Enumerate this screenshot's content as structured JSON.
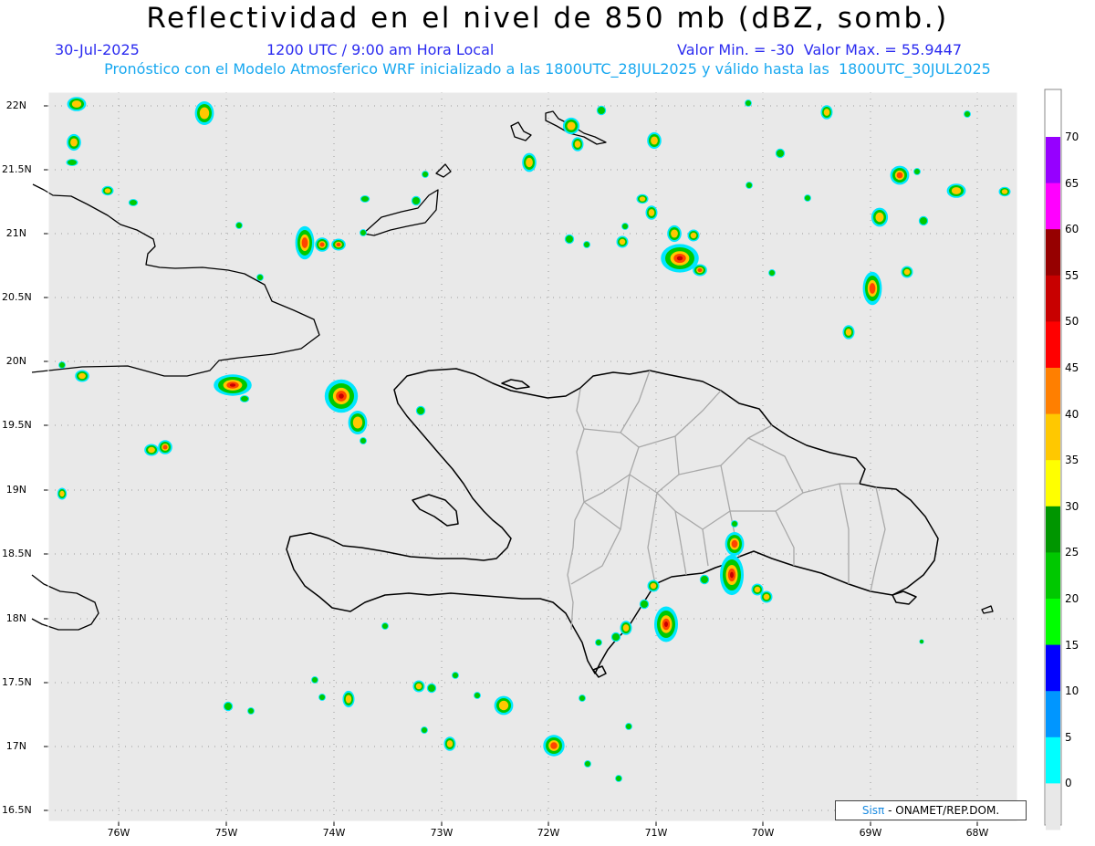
{
  "header": {
    "title": "Reflectividad en el nivel de 850 mb (dBZ, somb.)",
    "date": "30-Jul-2025",
    "time": "1200 UTC / 9:00 am Hora Local",
    "stats": "Valor Min. = -30  Valor Max. = 55.9447",
    "forecast": "Pronóstico con el Modelo Atmosferico WRF inicializado a las 1800UTC_28JUL2025 y válido hasta las  1800UTC_30JUL2025"
  },
  "axes": {
    "lat_labels": [
      "22N",
      "21.5N",
      "21N",
      "20.5N",
      "20N",
      "19.5N",
      "19N",
      "18.5N",
      "18N",
      "17.5N",
      "17N",
      "16.5N"
    ],
    "lon_labels": [
      "76W",
      "75W",
      "74W",
      "73W",
      "72W",
      "71W",
      "70W",
      "69W",
      "68W"
    ]
  },
  "colorbar": {
    "labels": [
      "70",
      "65",
      "60",
      "55",
      "50",
      "45",
      "40",
      "35",
      "30",
      "25",
      "20",
      "15",
      "10",
      "5",
      "0"
    ],
    "colors": [
      "#9600ff",
      "#ff00ff",
      "#960000",
      "#c80000",
      "#ff0000",
      "#ff7f00",
      "#ffc800",
      "#ffff00",
      "#009600",
      "#00c800",
      "#00ff00",
      "#0000ff",
      "#0096ff",
      "#00ffff",
      "#e8e8e8"
    ]
  },
  "credit": {
    "brand": "Sisπ",
    "text": "- ONAMET/REP.DOM."
  }
}
